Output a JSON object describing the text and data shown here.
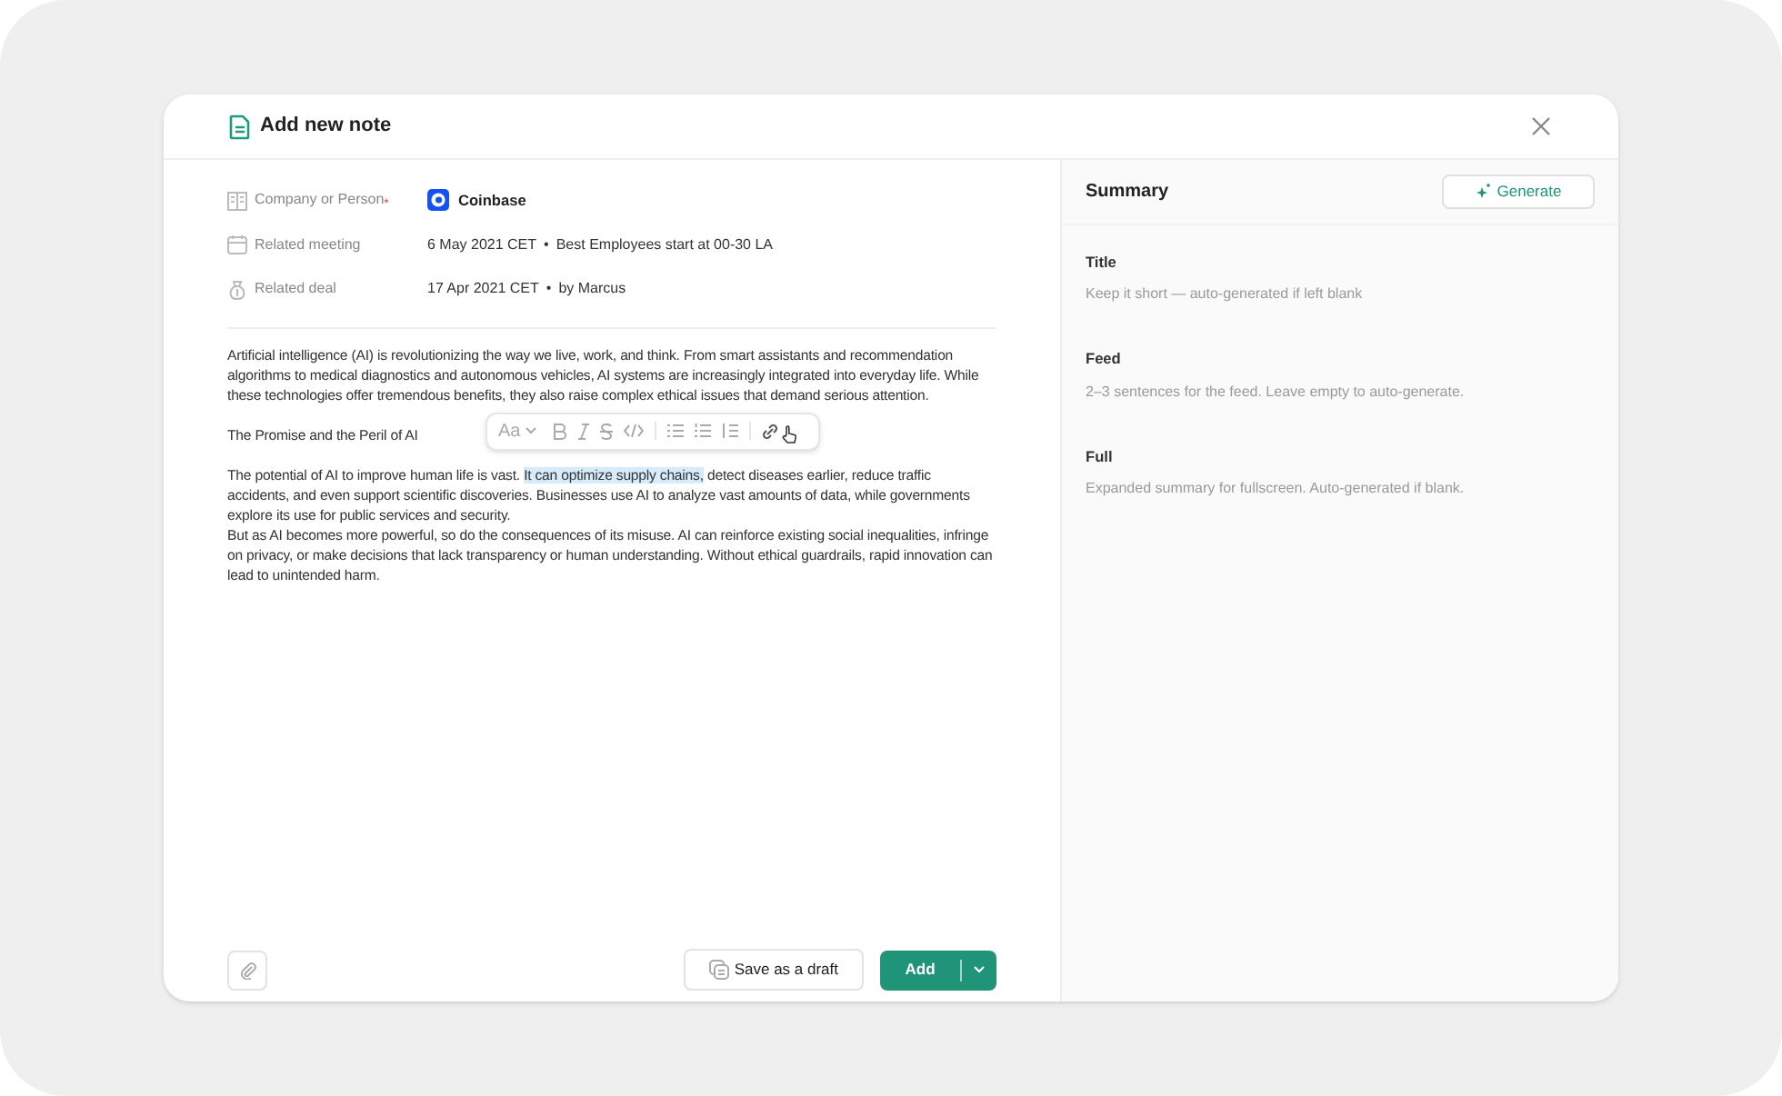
{
  "dialog": {
    "title": "Add new note"
  },
  "fields": [
    {
      "kind": "company",
      "label": "Company or Person",
      "required_mark": "*",
      "value": "Coinbase"
    },
    {
      "kind": "meeting",
      "label": "Related meeting",
      "date": "6 May 2021 CET",
      "separator": "•",
      "detail": "Best Employees start at 00-30 LA"
    },
    {
      "kind": "deal",
      "label": "Related deal",
      "date": "17 Apr 2021 CET",
      "separator": "•",
      "detail": "by Marcus"
    }
  ],
  "editor": {
    "intro": "Artificial intelligence (AI) is revolutionizing the way we live, work, and think. From smart assistants and recommendation algorithms to medical diagnostics and autonomous vehicles, AI systems are increasingly integrated into everyday life. While these technologies offer tremendous benefits, they also raise complex ethical issues that demand serious attention.",
    "heading": "The Promise and the Peril of AI",
    "toolbar": {
      "font_label": "Aa"
    },
    "paragraph": [
      {
        "text": "The potential of AI to improve human life is vast. ",
        "selected": false
      },
      {
        "text": "It can optimize supply chains,",
        "selected": true
      },
      {
        "text": " detect diseases earlier, reduce traffic accidents, and even support scientific discoveries. Businesses use AI to analyze vast amounts of data, while governments explore its use for public services and security.",
        "selected": false
      }
    ],
    "closing": "But as AI becomes more powerful, so do the consequences of its misuse. AI can reinforce existing social inequalities, infringe on privacy, or make decisions that lack transparency or human understanding. Without ethical guardrails, rapid innovation can lead to unintended harm."
  },
  "footer": {
    "draft_button": "Save as a draft",
    "add_button": "Add"
  },
  "summary": {
    "title": "Summary",
    "generate_button": "Generate",
    "sections": [
      {
        "label": "Title",
        "hint": "Keep it short — auto-generated if left blank"
      },
      {
        "label": "Feed",
        "hint": "2–3 sentences for the feed. Leave empty to auto-generate."
      },
      {
        "label": "Full",
        "hint": "Expanded summary for fullscreen. Auto-generated if blank."
      }
    ]
  }
}
